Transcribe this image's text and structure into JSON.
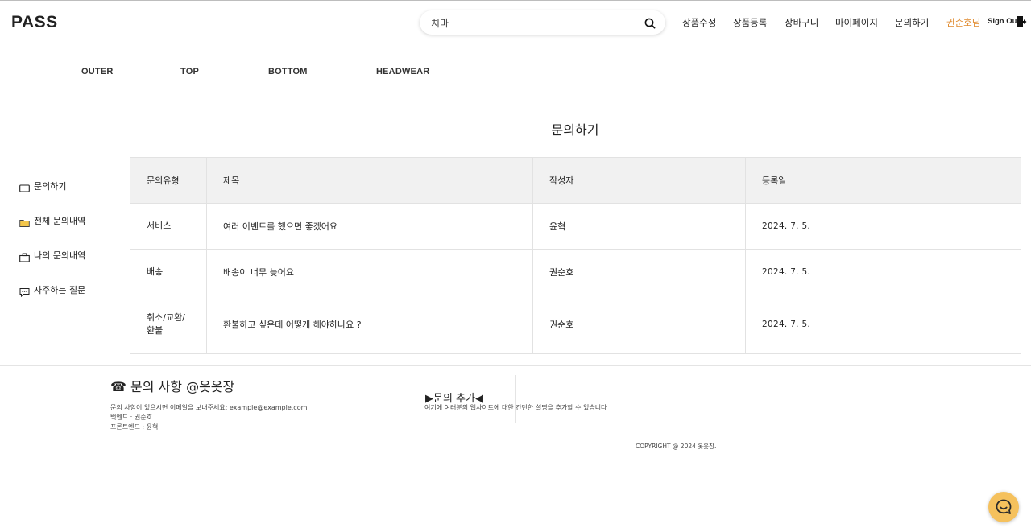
{
  "header": {
    "logo": "PASS",
    "search": {
      "value": "치마",
      "placeholder": ""
    },
    "nav": [
      "상품수정",
      "상품등록",
      "장바구니",
      "마이페이지",
      "문의하기"
    ],
    "user": "권순호님",
    "signout": "Sign Out",
    "accent_color": "#e08a2e"
  },
  "categories": [
    "OUTER",
    "TOP",
    "BOTTOM",
    "HEADWEAR"
  ],
  "page": {
    "title": "문의하기"
  },
  "sidebar": {
    "items": [
      {
        "icon": "mail-icon",
        "label": "문의하기"
      },
      {
        "icon": "folder-icon",
        "label": "전체 문의내역"
      },
      {
        "icon": "briefcase-icon",
        "label": "나의 문의내역"
      },
      {
        "icon": "chat-bubble-icon",
        "label": "자주하는 질문"
      }
    ]
  },
  "table": {
    "headers": [
      "문의유형",
      "제목",
      "작성자",
      "등록일"
    ],
    "rows": [
      {
        "type": "서비스",
        "title": "여러 이벤트를 했으면 좋겠어요",
        "author": "윤혁",
        "date": "2024. 7. 5."
      },
      {
        "type": "배송",
        "title": "배송이 너무 늦어요",
        "author": "권순호",
        "date": "2024. 7. 5."
      },
      {
        "type_line1": "취소/교환/",
        "type_line2": "환불",
        "title": "환불하고 싶은데 어떻게 해야하나요 ?",
        "author": "권순호",
        "date": "2024. 7. 5."
      }
    ]
  },
  "footer": {
    "contact_title": "☎ 문의 사항 @옷옷장",
    "contact_email": "문의 사항이 있으시면 이메일을 보내주세요: example@example.com",
    "backend": "백엔드 : 권순호",
    "frontend": "프론트엔드 : 윤혁",
    "add_title": "▶문의 추가◀",
    "add_desc": "여기에 여러분의 웹사이트에 대한 간단한 설명을 추가할 수 있습니다",
    "copyright": "COPYRIGHT @ 2024 옷옷장."
  },
  "chat": {
    "icon": "chat-smile-icon",
    "color": "#f5c15d"
  }
}
